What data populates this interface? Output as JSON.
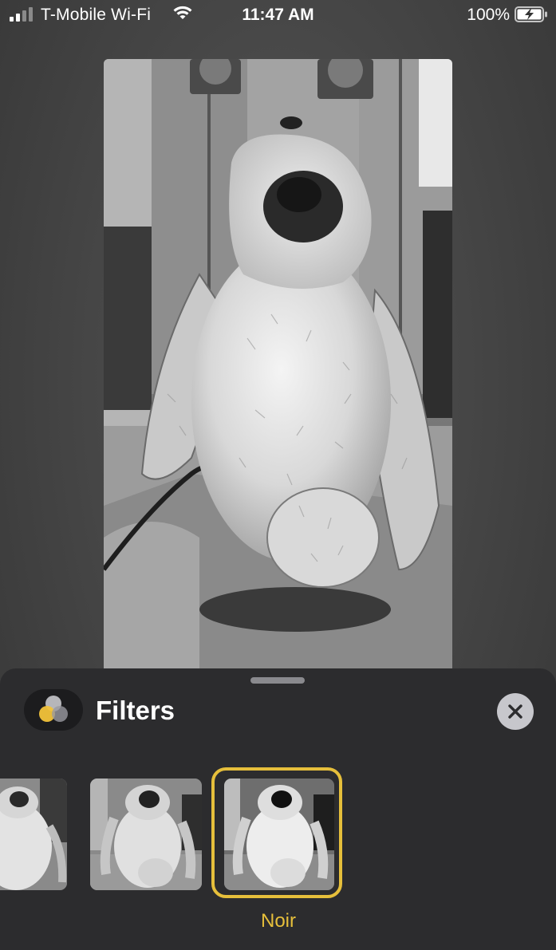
{
  "status_bar": {
    "carrier": "T-Mobile Wi-Fi",
    "time": "11:47 AM",
    "battery": "100%"
  },
  "photo": {
    "filter_applied": "Noir"
  },
  "sheet": {
    "title": "Filters",
    "close_icon": "close-icon",
    "badge_icon": "filters-icon",
    "filters": [
      {
        "label": "",
        "selected": false
      },
      {
        "label": "",
        "selected": false
      },
      {
        "label": "Noir",
        "selected": true
      }
    ],
    "selected_label": "Noir"
  },
  "colors": {
    "accent": "#e6bf3b",
    "sheet_bg": "#2c2c2e",
    "close_bg": "#c7c7cc"
  }
}
